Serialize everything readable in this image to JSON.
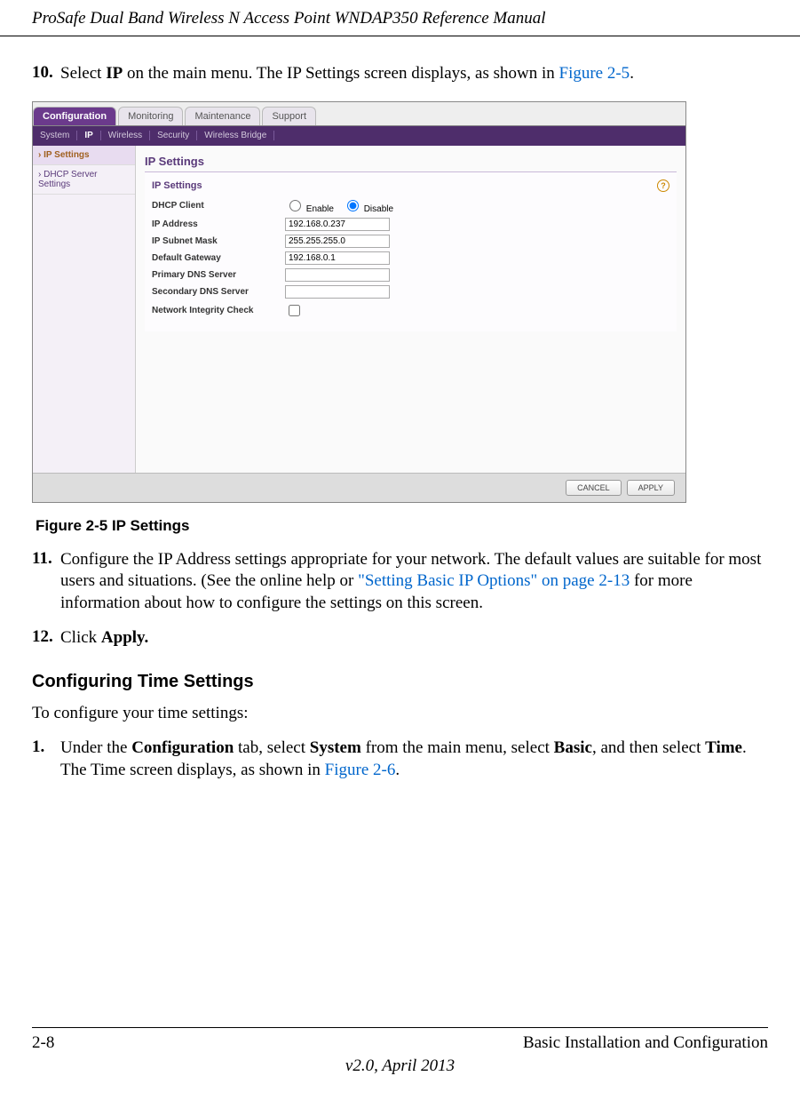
{
  "header": {
    "title": "ProSafe Dual Band Wireless N Access Point WNDAP350 Reference Manual"
  },
  "step10": {
    "num": "10.",
    "pre": "Select ",
    "bold": "IP",
    "post": " on the main menu. The IP Settings screen displays, as shown in ",
    "link": "Figure 2-5",
    "end": "."
  },
  "screenshot": {
    "tabs": [
      "Configuration",
      "Monitoring",
      "Maintenance",
      "Support"
    ],
    "subtabs": [
      "System",
      "IP",
      "Wireless",
      "Security",
      "Wireless Bridge"
    ],
    "sidebar": [
      "IP Settings",
      "DHCP Server Settings"
    ],
    "panel_heading": "IP Settings",
    "panel_subhead": "IP Settings",
    "rows": {
      "dhcp_label": "DHCP Client",
      "dhcp_enable": "Enable",
      "dhcp_disable": "Disable",
      "ip_label": "IP Address",
      "ip_value": "192.168.0.237",
      "mask_label": "IP Subnet Mask",
      "mask_value": "255.255.255.0",
      "gw_label": "Default Gateway",
      "gw_value": "192.168.0.1",
      "pdns_label": "Primary DNS Server",
      "pdns_value": "",
      "sdns_label": "Secondary DNS Server",
      "sdns_value": "",
      "nic_label": "Network Integrity Check"
    },
    "buttons": {
      "cancel": "CANCEL",
      "apply": "APPLY"
    }
  },
  "figure_caption": "Figure 2-5  IP Settings",
  "step11": {
    "num": "11.",
    "text1": "Configure the IP Address settings appropriate for your network. The default values are suitable for most users and situations. (See the online help or ",
    "link": "\"Setting Basic IP Options\" on page 2-13",
    "text2": " for more information about how to configure the settings on this screen."
  },
  "step12": {
    "num": "12.",
    "pre": "Click ",
    "bold": "Apply."
  },
  "section_heading": "Configuring Time Settings",
  "body_para": "To configure your time settings:",
  "step_nested1": {
    "num": "1.",
    "p1": "Under the ",
    "b1": "Configuration",
    "p2": " tab, select ",
    "b2": "System",
    "p3": " from the main menu, select ",
    "b3": "Basic",
    "p4": ", and then select ",
    "b4": "Time",
    "p5": ". The Time screen displays, as shown in ",
    "link": "Figure 2-6",
    "end": "."
  },
  "footer": {
    "left": "2-8",
    "right": "Basic Installation and Configuration",
    "center": "v2.0, April 2013"
  }
}
